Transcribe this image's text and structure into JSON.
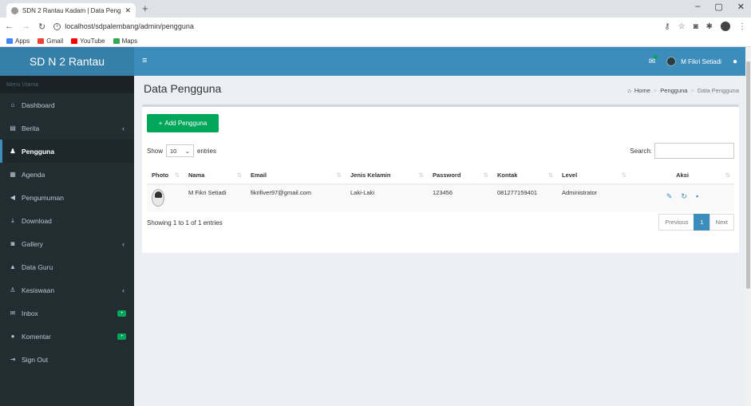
{
  "browser": {
    "tab_title": "SDN 2 Rantau Kadam | Data Peng",
    "new_tab": "+",
    "url": "localhost/sdpalembang/admin/pengguna",
    "bookmarks": [
      {
        "label": "Apps",
        "icon": "apps-icon"
      },
      {
        "label": "Gmail",
        "icon": "gmail-icon"
      },
      {
        "label": "YouTube",
        "icon": "youtube-icon"
      },
      {
        "label": "Maps",
        "icon": "maps-icon"
      }
    ]
  },
  "sidebar": {
    "logo": "SD N 2 Rantau",
    "header": "Menu Utama",
    "items": [
      {
        "label": "Dashboard",
        "icon": "home-icon"
      },
      {
        "label": "Berita",
        "icon": "newspaper-icon"
      },
      {
        "label": "Pengguna",
        "icon": "users-icon"
      },
      {
        "label": "Agenda",
        "icon": "calendar-icon"
      },
      {
        "label": "Pengumuman",
        "icon": "bullhorn-icon"
      },
      {
        "label": "Download",
        "icon": "download-icon"
      },
      {
        "label": "Gallery",
        "icon": "camera-icon"
      },
      {
        "label": "Data Guru",
        "icon": "graduation-icon"
      },
      {
        "label": "Kesiswaan",
        "icon": "user-icon"
      },
      {
        "label": "Inbox",
        "icon": "envelope-icon"
      },
      {
        "label": "Komentar",
        "icon": "comments-icon"
      },
      {
        "label": "Sign Out",
        "icon": "sign-out-icon"
      }
    ]
  },
  "topbar": {
    "user_name": "M Fikri Setiadi"
  },
  "page": {
    "title": "Data Pengguna",
    "breadcrumb": [
      "Home",
      "Pengguna",
      "Data Pengguna"
    ]
  },
  "toolbar": {
    "add_label": "Add Pengguna",
    "show_label": "Show",
    "entries_value": "10",
    "entries_label": "entries",
    "search_label": "Search:"
  },
  "table": {
    "headers": [
      "Photo",
      "Nama",
      "Email",
      "Jenis Kelamin",
      "Password",
      "Kontak",
      "Level",
      "Aksi"
    ],
    "rows": [
      {
        "nama": "M Fikri Setiadi",
        "email": "fikrifiver97@gmail.com",
        "jenis_kelamin": "Laki-Laki",
        "password": "123456",
        "kontak": "081277159401",
        "level": "Administrator"
      }
    ]
  },
  "footer": {
    "info": "Showing 1 to 1 of 1 entries",
    "previous": "Previous",
    "page": "1",
    "next": "Next"
  },
  "colors": {
    "brand": "#367fa9",
    "topbar": "#3c8dbc",
    "sidebar": "#222d32",
    "add_button": "#00a65a"
  }
}
